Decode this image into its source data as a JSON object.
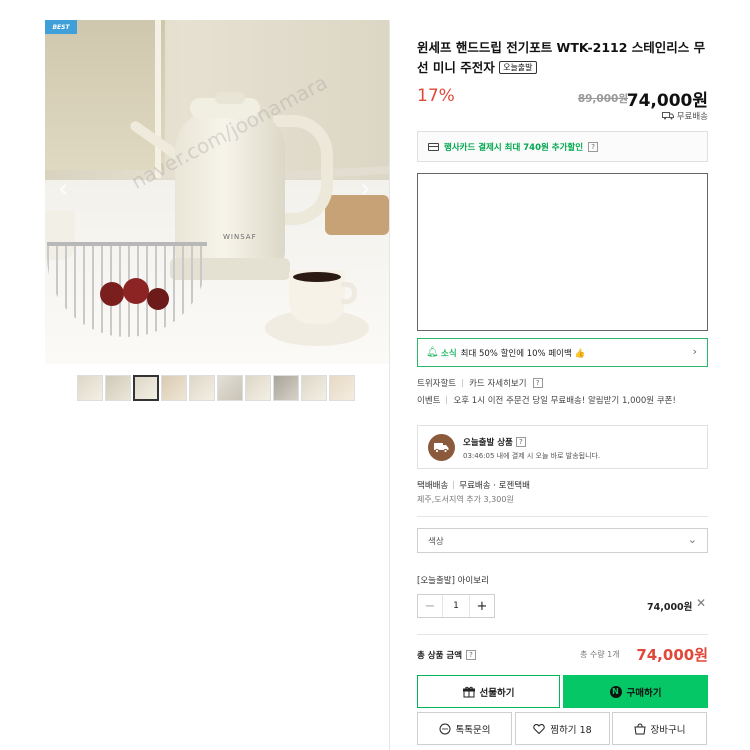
{
  "gallery": {
    "badge": "BEST",
    "prev_arrow": "‹",
    "next_arrow": "›",
    "watermark": "naver.com/joonamara",
    "brand_on_kettle": "WINSAF",
    "thumbnail_count": 10,
    "active_thumbnail": 3
  },
  "product": {
    "title": "윈세프 핸드드립 전기포트 WTK-2112 스테인리스 무선 미니 주전자",
    "title_badge": "오늘출발",
    "discount": "17%",
    "original_price": "89,000원",
    "sale_price": "74,000원",
    "shipping_label": "무료배송"
  },
  "card_promo": {
    "text": "행사카드 결제시 최대 740원 추가할인",
    "help": "?"
  },
  "notice": {
    "tag": "소식",
    "text": "최대 50% 할인에 10% 페이백 👍",
    "chevron": "›"
  },
  "links": {
    "a": "트위자할트",
    "b": "카드 자세히보기",
    "help": "?"
  },
  "event": {
    "label": "이벤트",
    "text": "오후 1시 이전 주문건 당일 무료배송! 알림받기 1,000원 쿠폰!"
  },
  "today_ship": {
    "title": "오늘출발 상품",
    "help": "?",
    "desc": "03:46:05 내에 결제 시 오늘 바로 발송됩니다."
  },
  "delivery": {
    "type": "택배배송",
    "detail": "무료배송 · 로젠택배",
    "extra": "제주,도서지역 추가 3,300원"
  },
  "option": {
    "placeholder": "색상",
    "chevron": "⌄",
    "selected_name": "[오늘출발] 아이보리",
    "quantity": "1",
    "minus": "−",
    "plus": "+",
    "line_price": "74,000원",
    "remove": "✕"
  },
  "total": {
    "label": "총 상품 금액",
    "help": "?",
    "count": "총 수량 1개",
    "price": "74,000원"
  },
  "buttons": {
    "gift": "선물하기",
    "buy": "구매하기",
    "n_logo": "N",
    "talk": "톡톡문의",
    "like": "찜하기 18",
    "cart": "장바구니"
  },
  "colors": {
    "accent_green": "#05c765",
    "price_red": "#e0493a",
    "badge_blue": "#3f9fd8"
  },
  "icons": [
    "truck-icon",
    "card-icon",
    "bell-icon",
    "gift-icon",
    "talk-icon",
    "heart-icon",
    "cart-icon",
    "chevron-down-icon",
    "close-icon"
  ]
}
